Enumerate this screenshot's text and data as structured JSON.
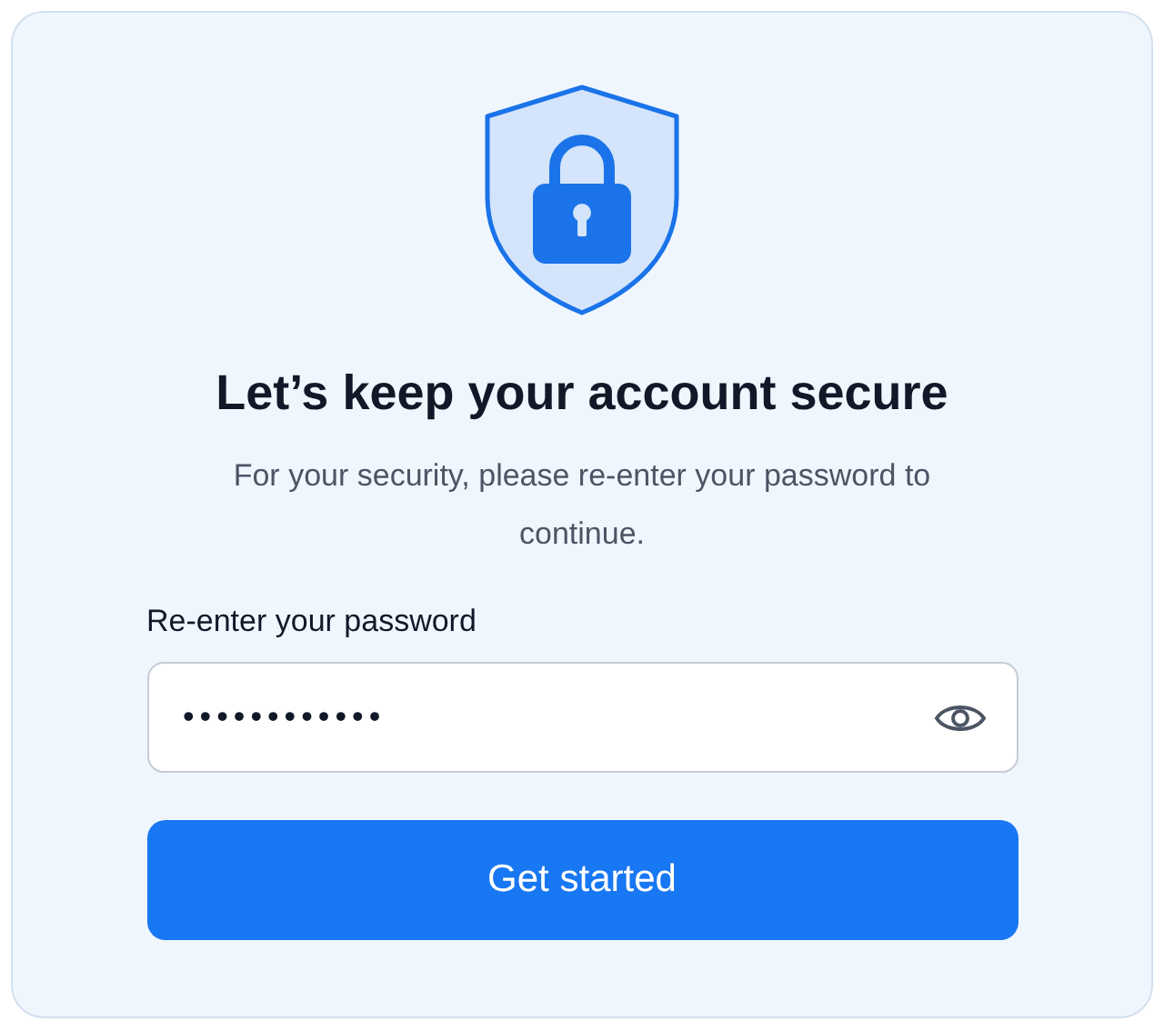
{
  "title": "Let’s keep your account secure",
  "message": "For your security, please re-enter your password to continue.",
  "password_field": {
    "label": "Re-enter your password",
    "value": "••••••••••••"
  },
  "button": {
    "label": "Get started"
  }
}
